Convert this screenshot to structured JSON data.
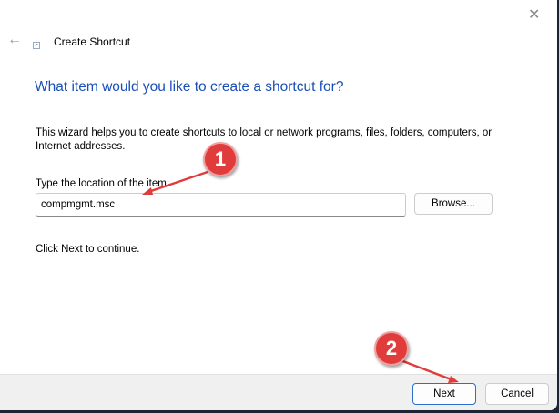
{
  "window": {
    "title": "Create Shortcut"
  },
  "heading": "What item would you like to create a shortcut for?",
  "description": "This wizard helps you to create shortcuts to local or network programs, files, folders, computers, or Internet addresses.",
  "location": {
    "label": "Type the location of the item:",
    "value": "compmgmt.msc",
    "browse": "Browse..."
  },
  "continue_text": "Click Next to continue.",
  "footer": {
    "next": "Next",
    "cancel": "Cancel"
  },
  "annotations": [
    "1",
    "2"
  ],
  "colors": {
    "heading": "#1a4fb8",
    "annotation": "#e03c3c"
  }
}
